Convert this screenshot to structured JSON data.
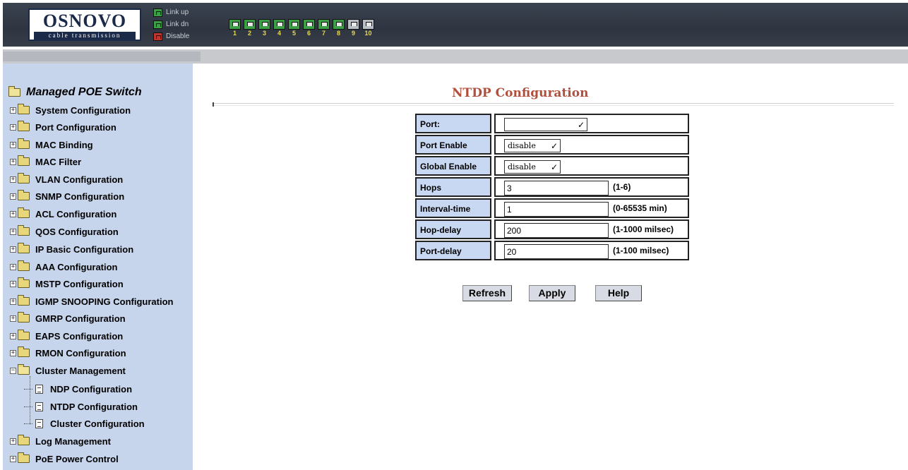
{
  "header": {
    "brand": "OSNOVO",
    "tagline": "cable transmission",
    "legend": [
      {
        "label": "Link up",
        "color": "#3aa043"
      },
      {
        "label": "Link dn",
        "color": "#3aa043"
      },
      {
        "label": "Disable",
        "color": "#c0362c"
      }
    ],
    "ports": [
      {
        "num": "1",
        "state": "up"
      },
      {
        "num": "2",
        "state": "up"
      },
      {
        "num": "3",
        "state": "up"
      },
      {
        "num": "4",
        "state": "up"
      },
      {
        "num": "5",
        "state": "up"
      },
      {
        "num": "6",
        "state": "up"
      },
      {
        "num": "7",
        "state": "up"
      },
      {
        "num": "8",
        "state": "up"
      },
      {
        "num": "9",
        "state": "dn"
      },
      {
        "num": "10",
        "state": "dn"
      }
    ]
  },
  "sidebar": {
    "root": "Managed POE Switch",
    "items": [
      "System Configuration",
      "Port Configuration",
      "MAC Binding",
      "MAC Filter",
      "VLAN Configuration",
      "SNMP Configuration",
      "ACL Configuration",
      "QOS Configuration",
      "IP Basic Configuration",
      "AAA Configuration",
      "MSTP Configuration",
      "IGMP SNOOPING Configuration",
      "GMRP Configuration",
      "EAPS Configuration",
      "RMON Configuration",
      "Cluster Management"
    ],
    "cluster_children": [
      "NDP Configuration",
      "NTDP Configuration",
      "Cluster Configuration"
    ],
    "trailing_items": [
      "Log Management",
      "PoE Power Control"
    ]
  },
  "main": {
    "title": "NTDP Configuration",
    "rows": [
      {
        "label": "Port:",
        "type": "select",
        "value": ""
      },
      {
        "label": "Port Enable",
        "type": "select",
        "value": "disable"
      },
      {
        "label": "Global Enable",
        "type": "select",
        "value": "disable"
      },
      {
        "label": "Hops",
        "type": "text",
        "value": "3",
        "hint": "(1-6)"
      },
      {
        "label": "Interval-time",
        "type": "text",
        "value": "1",
        "hint": "(0-65535 min)"
      },
      {
        "label": "Hop-delay",
        "type": "text",
        "value": "200",
        "hint": "(1-1000 milsec)"
      },
      {
        "label": "Port-delay",
        "type": "text",
        "value": "20",
        "hint": "(1-100 milsec)"
      }
    ],
    "buttons": {
      "refresh": "Refresh",
      "apply": "Apply",
      "help": "Help"
    }
  }
}
